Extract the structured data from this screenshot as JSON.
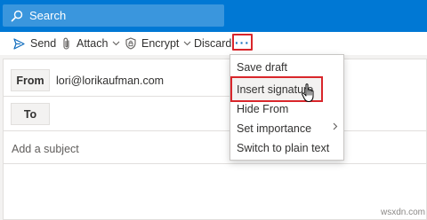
{
  "search": {
    "placeholder": "Search"
  },
  "toolbar": {
    "send_label": "Send",
    "attach_label": "Attach",
    "encrypt_label": "Encrypt",
    "discard_label": "Discard",
    "more_label": "···"
  },
  "compose": {
    "from_label": "From",
    "from_value": "lori@lorikaufman.com",
    "to_label": "To",
    "subject_placeholder": "Add a subject"
  },
  "menu": {
    "items": [
      {
        "label": "Save draft"
      },
      {
        "label": "Insert signature"
      },
      {
        "label": "Hide From"
      },
      {
        "label": "Set importance",
        "has_submenu": true
      },
      {
        "label": "Switch to plain text"
      }
    ]
  },
  "watermark": "wsxdn.com",
  "colors": {
    "header_blue": "#0078d4",
    "search_bg": "#3a96dd",
    "highlight_red": "#d9262b",
    "accent_blue": "#0f6cbd"
  },
  "icons": [
    "search-icon",
    "send-icon",
    "paperclip-icon",
    "shield-lock-icon",
    "chevron-down-icon",
    "chevron-right-icon",
    "hand-cursor-icon"
  ]
}
